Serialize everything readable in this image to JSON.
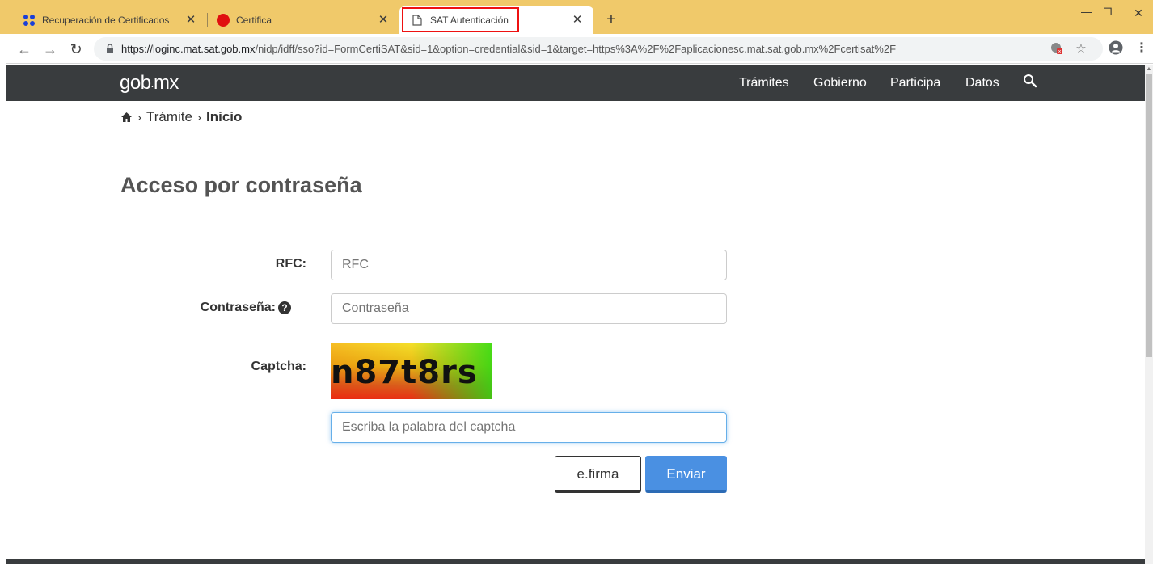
{
  "browser": {
    "tabs": [
      {
        "title": "Recuperación de Certificados",
        "icon": "grid-dots-icon",
        "active": false
      },
      {
        "title": "Certifica",
        "icon": "red-circle-icon",
        "active": false
      },
      {
        "title": "SAT Autenticación",
        "icon": "document-icon",
        "active": true
      }
    ],
    "new_tab_label": "+",
    "url_host": "https://loginc.mat.sat.gob.mx",
    "url_rest": "/nidp/idff/sso?id=FormCertiSAT&sid=1&option=credential&sid=1&target=https%3A%2F%2Faplicacionesc.mat.sat.gob.mx%2Fcertisat%2F"
  },
  "site": {
    "logo_left": "gob",
    "logo_right": "mx",
    "nav": [
      "Trámites",
      "Gobierno",
      "Participa",
      "Datos"
    ]
  },
  "breadcrumb": {
    "items": [
      "Trámite",
      "Inicio"
    ]
  },
  "form": {
    "title": "Acceso por contraseña",
    "rfc_label": "RFC:",
    "rfc_placeholder": "RFC",
    "password_label": "Contraseña:",
    "password_placeholder": "Contraseña",
    "captcha_label": "Captcha:",
    "captcha_text": "n87t8rs",
    "captcha_placeholder": "Escriba la palabra del captcha",
    "efirma_label": "e.firma",
    "submit_label": "Enviar"
  },
  "colors": {
    "tabstrip": "#f0c96a",
    "navbar": "#393c3e",
    "primary_button": "#4a90e2",
    "highlight_border": "#e11111"
  }
}
